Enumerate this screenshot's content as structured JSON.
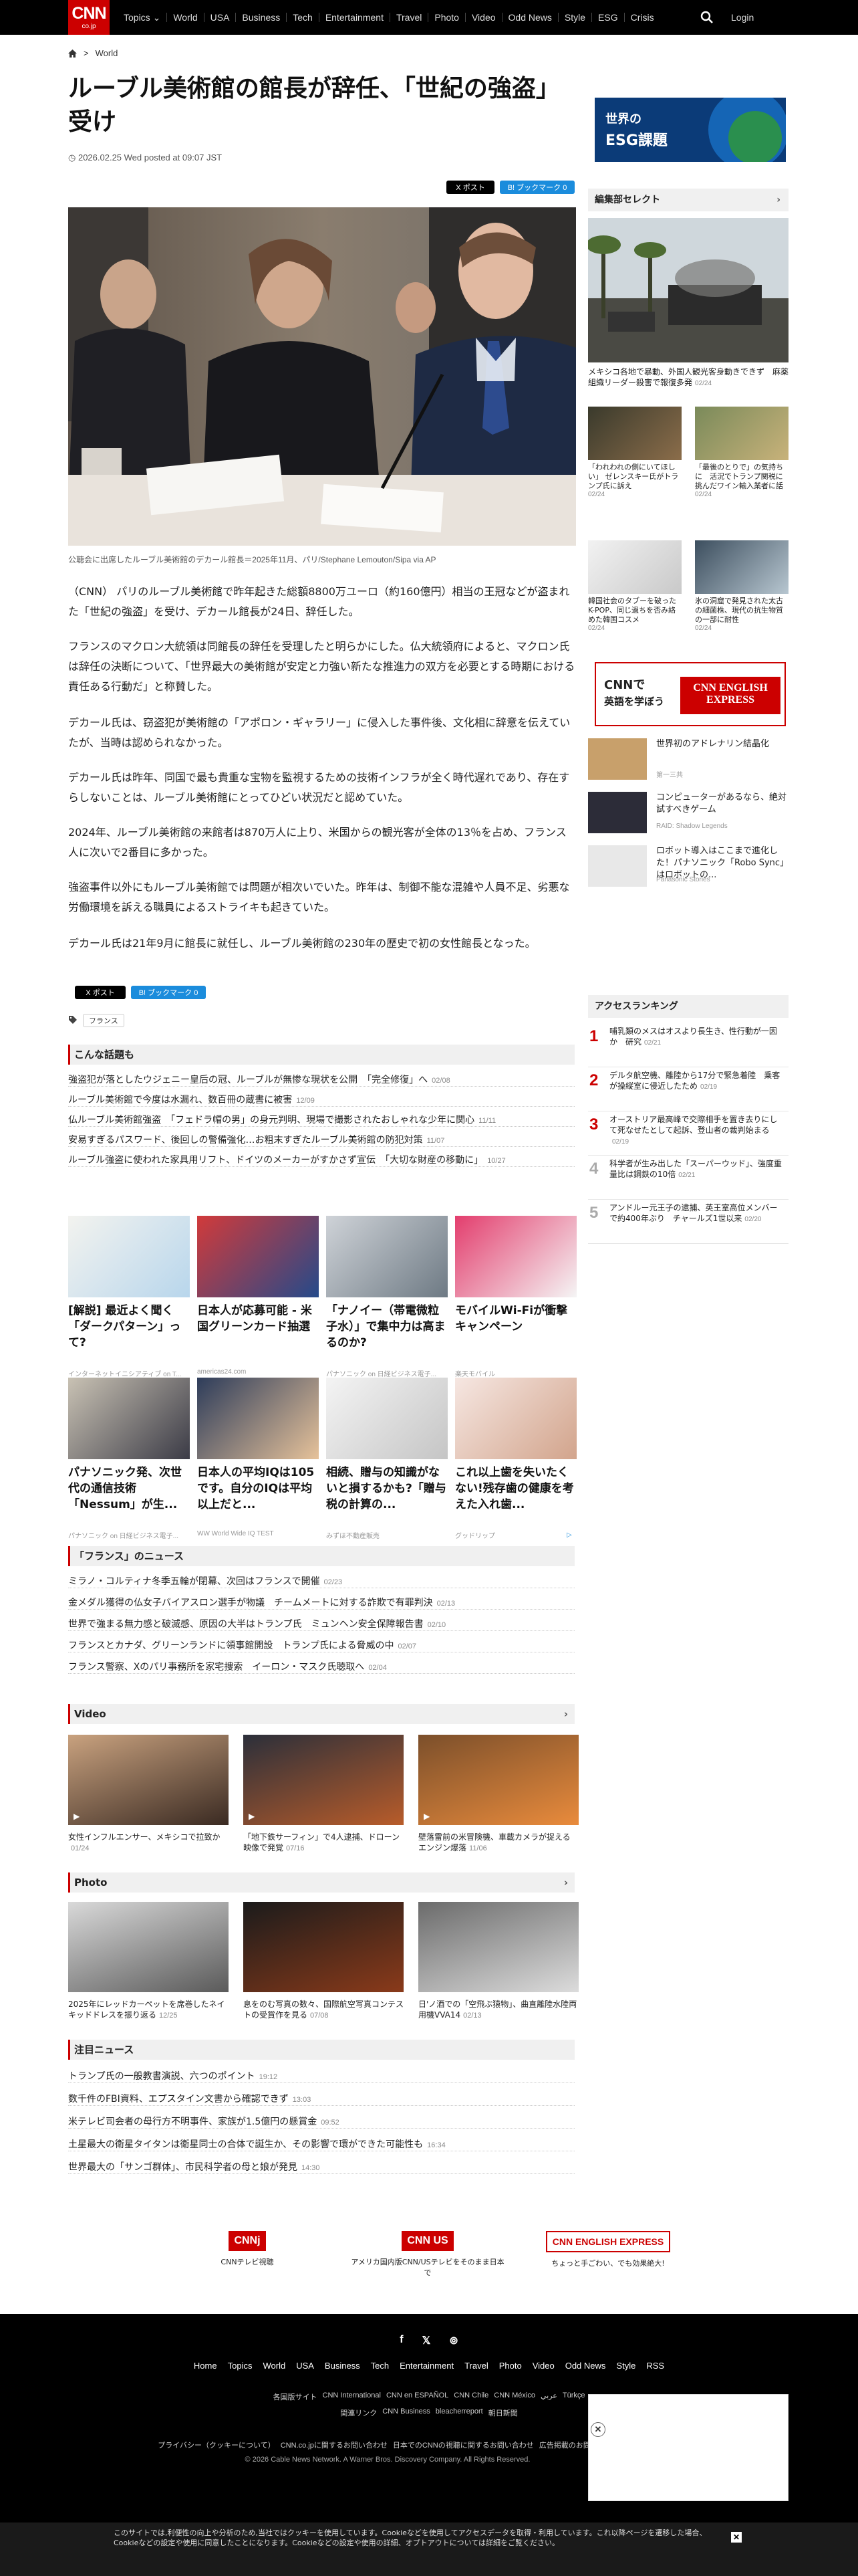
{
  "header": {
    "logo": "CNN",
    "logo_sub": "co.jp",
    "nav": [
      "Topics ⌄",
      "World",
      "USA",
      "Business",
      "Tech",
      "Entertainment",
      "Travel",
      "Photo",
      "Video",
      "Odd News",
      "Style",
      "ESG",
      "Crisis"
    ],
    "login": "Login"
  },
  "breadcrumb": {
    "current": "World"
  },
  "article": {
    "title": "ルーブル美術館の館長が辞任、「世紀の強盗」受け",
    "date": "2026.02.25 Wed posted at 09:07 JST",
    "share_x": "X ポスト",
    "share_hatena": "B! ブックマーク 0",
    "caption": "公聴会に出席したルーブル美術館のデカール館長＝2025年11月、パリ/Stephane Lemouton/Sipa via AP",
    "paragraphs": [
      "（CNN） パリのルーブル美術館で昨年起きた総額8800万ユーロ（約160億円）相当の王冠などが盗まれた「世紀の強盗」を受け、デカール館長が24日、辞任した。",
      "フランスのマクロン大統領は同館長の辞任を受理したと明らかにした。仏大統領府によると、マクロン氏は辞任の決断について、「世界最大の美術館が安定と力強い新たな推進力の双方を必要とする時期における責任ある行動だ」と称賛した。",
      "デカール氏は、窃盗犯が美術館の「アポロン・ギャラリー」に侵入した事件後、文化相に辞意を伝えていたが、当時は認められなかった。",
      "デカール氏は昨年、同国で最も貴重な宝物を監視するための技術インフラが全く時代遅れであり、存在すらしないことは、ルーブル美術館にとってひどい状況だと認めていた。",
      "2024年、ルーブル美術館の来館者は870万人に上り、米国からの観光客が全体の13％を占め、フランス人に次いで2番目に多かった。",
      "強盗事件以外にもルーブル美術館では問題が相次いでいた。昨年は、制御不能な混雑や人員不足、劣悪な労働環境を訴える職員によるストライキも起きていた。",
      "デカール氏は21年9月に館長に就任し、ルーブル美術館の230年の歴史で初の女性館長となった。"
    ],
    "tag": "フランス"
  },
  "related": {
    "heading": "こんな話題も",
    "items": [
      {
        "text": "強盗犯が落としたウジェニー皇后の冠、ルーブルが無惨な現状を公開　「完全修復」へ",
        "date": "02/08"
      },
      {
        "text": "ルーブル美術館で今度は水漏れ、数百冊の蔵書に被害",
        "date": "12/09"
      },
      {
        "text": "仏ルーブル美術館強盗　「フェドラ帽の男」の身元判明、現場で撮影されたおしゃれな少年に関心",
        "date": "11/11"
      },
      {
        "text": "安易すぎるパスワード、後回しの警備強化…お粗末すぎたルーブル美術館の防犯対策",
        "date": "11/07"
      },
      {
        "text": "ルーブル強盗に使われた家具用リフト、ドイツのメーカーがすかさず宣伝　「大切な財産の移動に」",
        "date": "10/27"
      }
    ]
  },
  "ads": [
    {
      "title": "[解説] 最近よく聞く「ダークパターン」って?",
      "source": "インターネットイニシアティブ on T..."
    },
    {
      "title": "日本人が応募可能 - 米国グリーンカード抽選",
      "source": "americas24.com"
    },
    {
      "title": "「ナノイー（帯電微粒子水）」で集中力は高まるのか?",
      "source": "パナソニック on 日経ビジネス電子..."
    },
    {
      "title": "モバイルWi-Fiが衝撃キャンペーン",
      "source": "楽天モバイル"
    },
    {
      "title": "パナソニック発、次世代の通信技術「Nessum」が生...",
      "source": "パナソニック on 日経ビジネス電子..."
    },
    {
      "title": "日本人の平均IQは105です。自分のIQは平均以上だと...",
      "source": "WW World Wide IQ TEST"
    },
    {
      "title": "相続、贈与の知識がないと損するかも?「贈与税の計算の...",
      "source": "みずほ不動産販売"
    },
    {
      "title": "これ以上歯を失いたくない!残存歯の健康を考えた入れ歯...",
      "source": "グッドリップ"
    }
  ],
  "france_news": {
    "heading": "「フランス」のニュース",
    "items": [
      {
        "text": "ミラノ・コルティナ冬季五輪が閉幕、次回はフランスで開催",
        "date": "02/23"
      },
      {
        "text": "金メダル獲得の仏女子バイアスロン選手が物議　チームメートに対する詐欺で有罪判決",
        "date": "02/13"
      },
      {
        "text": "世界で強まる無力感と破滅感、原因の大半はトランプ氏　ミュンヘン安全保障報告書",
        "date": "02/10"
      },
      {
        "text": "フランスとカナダ、グリーンランドに領事館開設　トランプ氏による脅威の中",
        "date": "02/07"
      },
      {
        "text": "フランス警察、Xのパリ事務所を家宅捜索　イーロン・マスク氏聴取へ",
        "date": "02/04"
      }
    ]
  },
  "video": {
    "heading": "Video",
    "items": [
      {
        "title": "女性インフルエンサー、メキシコで拉致か",
        "date": "01/24"
      },
      {
        "title": "「地下鉄サーフィン」で4人逮捕、ドローン映像で発覚",
        "date": "07/16"
      },
      {
        "title": "壁落雷前の米冒険機、車載カメラが捉える　エンジン爆落",
        "date": "11/06"
      }
    ]
  },
  "photo": {
    "heading": "Photo",
    "items": [
      {
        "title": "2025年にレッドカーペットを席巻したネイキッドドレスを振り返る",
        "date": "12/25"
      },
      {
        "title": "息をのむ写真の数々、国際航空写真コンテストの受賞作を見る",
        "date": "07/08"
      },
      {
        "title": "日'ノ酒での「空飛ぶ猿物」、曲直離陸水陸両用機VVA14",
        "date": "02/13"
      }
    ]
  },
  "featured": {
    "heading": "注目ニュース",
    "items": [
      {
        "text": "トランプ氏の一般教書演説、六つのポイント",
        "date": "19:12"
      },
      {
        "text": "数千件のFBI資料、エプスタイン文書から確認できず",
        "date": "13:03"
      },
      {
        "text": "米テレビ司会者の母行方不明事件、家族が1.5億円の懸賞金",
        "date": "09:52"
      },
      {
        "text": "土星最大の衛星タイタンは衛星同士の合体で誕生か、その影響で環ができた可能性も",
        "date": "16:34"
      },
      {
        "text": "世界最大の「サンゴ群体」、市民科学者の母と娘が発見",
        "date": "14:30"
      }
    ]
  },
  "promos": [
    {
      "logo": "CNNj",
      "label": "CNNテレビ視聴"
    },
    {
      "logo": "CNN US",
      "label": "アメリカ国内版CNN/USテレビをそのまま日本で"
    },
    {
      "logo": "CNN ENGLISH EXPRESS",
      "label": "ちょっと手ごわい、でも効果絶大!"
    }
  ],
  "sidebar": {
    "esg": {
      "line1": "世界の",
      "line2": "ESG課題"
    },
    "editor_heading": "編集部セレクト",
    "editor_main": {
      "title": "メキシコ各地で暴動、外国人観光客身動きできず　麻薬組織リーダー殺害で報復多発",
      "date": "02/24"
    },
    "editor_items": [
      {
        "title": "「われわれの側にいてほしい」 ゼレンスキー氏がトランプ氏に訴え",
        "date": "02/24"
      },
      {
        "title": "「最後のとりで」の気持ちに　活況でトランプ関税に挑んだワイン輸入業者に話を聞く",
        "date": "02/24"
      },
      {
        "title": "韓国社会のタブーを破ったK-POP、同じ過ちを否み絡めた韓国コスメ",
        "date": "02/24"
      },
      {
        "title": "氷の洞窟で発見された太古の細菌株、現代の抗生物質の一部に耐性",
        "date": "02/24"
      }
    ],
    "ee_banner": {
      "left1": "CNNで",
      "left2": "英語を学ぼう",
      "right1": "CNN ENGLISH",
      "right2": "EXPRESS"
    },
    "sponsored": [
      {
        "title": "世界初のアドレナリン結晶化",
        "source": "第一三共"
      },
      {
        "title": "コンピューターがあるなら、絶対試すべきゲーム",
        "source": "RAID: Shadow Legends"
      },
      {
        "title": "ロボット導入はここまで進化した！パナソニック「Robo Sync」はロボットの...",
        "source": "Panasonic Stories"
      }
    ],
    "ranking_heading": "アクセスランキング",
    "ranking": [
      {
        "n": "1",
        "title": "哺乳類のメスはオスより長生き、性行動が一因か　研究",
        "date": "02/21"
      },
      {
        "n": "2",
        "title": "デルタ航空機、離陸から17分で緊急着陸　乗客が操縦室に侵近したため",
        "date": "02/19"
      },
      {
        "n": "3",
        "title": "オーストリア最高峰で交際相手を置き去りにして死なせたとして起訴、登山者の裁判始まる",
        "date": "02/19"
      },
      {
        "n": "4",
        "title": "科学者が生み出した「スーパーウッド」、強度重量比は鋼鉄の10倍",
        "date": "02/21"
      },
      {
        "n": "5",
        "title": "アンドルー元王子の逮捕、英王室高位メンバーで約400年ぶり　チャールズ1世以来",
        "date": "02/20"
      }
    ]
  },
  "footer": {
    "nav": [
      "Home",
      "Topics",
      "World",
      "USA",
      "Business",
      "Tech",
      "Entertainment",
      "Travel",
      "Photo",
      "Video",
      "Odd News",
      "Style",
      "RSS"
    ],
    "links1": [
      "各国版サイト",
      "CNN International",
      "CNN en ESPAÑOL",
      "CNN Chile",
      "CNN México",
      "عربي",
      "Türkçe"
    ],
    "links2": [
      "関連リンク",
      "CNN Business",
      "bleacherreport",
      "朝日新聞"
    ],
    "legal": [
      "プライバシー（クッキーについて）",
      "CNN.co.jpに関するお問い合わせ",
      "日本でのCNNの視聴に関するお問い合わせ",
      "広告掲載のお問い合わせ"
    ],
    "copyright": "© 2026 Cable News Network. A Warner Bros. Discovery Company. All Rights Reserved."
  },
  "cookie": {
    "text": "このサイトでは,利便性の向上や分析のため,当社ではクッキーを使用しています。Cookieなどを使用してアクセスデータを取得・利用しています。これ以降ページを遷移した場合、Cookieなどの設定や使用に同意したことになります。Cookieなどの設定や使用の詳細、オプトアウトについては詳細をご覧ください。"
  }
}
